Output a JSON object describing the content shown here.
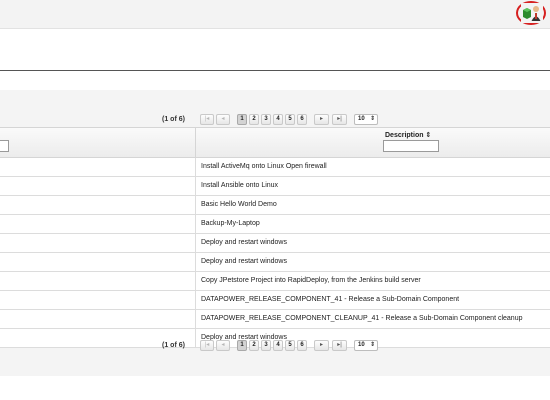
{
  "header": {
    "user_icon": "user-avatar-icon"
  },
  "pagination": {
    "page_info": "(1 of 6)",
    "first_label": "|◂",
    "prev_label": "◂",
    "pages": [
      "1",
      "2",
      "3",
      "4",
      "5",
      "6"
    ],
    "current_page": "1",
    "next_label": "▸",
    "last_label": "▸|",
    "rows_per_page": "10"
  },
  "table": {
    "columns": {
      "description": "Description ⇕"
    },
    "rows": [
      "Install ActiveMq onto Linux Open firewall",
      "Install Ansible onto Linux",
      "Basic Hello World Demo",
      "Backup-My-Laptop",
      "Deploy and restart windows",
      "Deploy and restart windows",
      "Copy JPetstore Project into RapidDeploy, from the Jenkins build server",
      "DATAPOWER_RELEASE_COMPONENT_41 - Release a Sub-Domain Component",
      "DATAPOWER_RELEASE_COMPONENT_CLEANUP_41 - Release a Sub-Domain Component cleanup",
      "Deploy and restart windows"
    ]
  },
  "colors": {
    "accent_ring": "#d62020",
    "background": "#f4f4f4"
  }
}
